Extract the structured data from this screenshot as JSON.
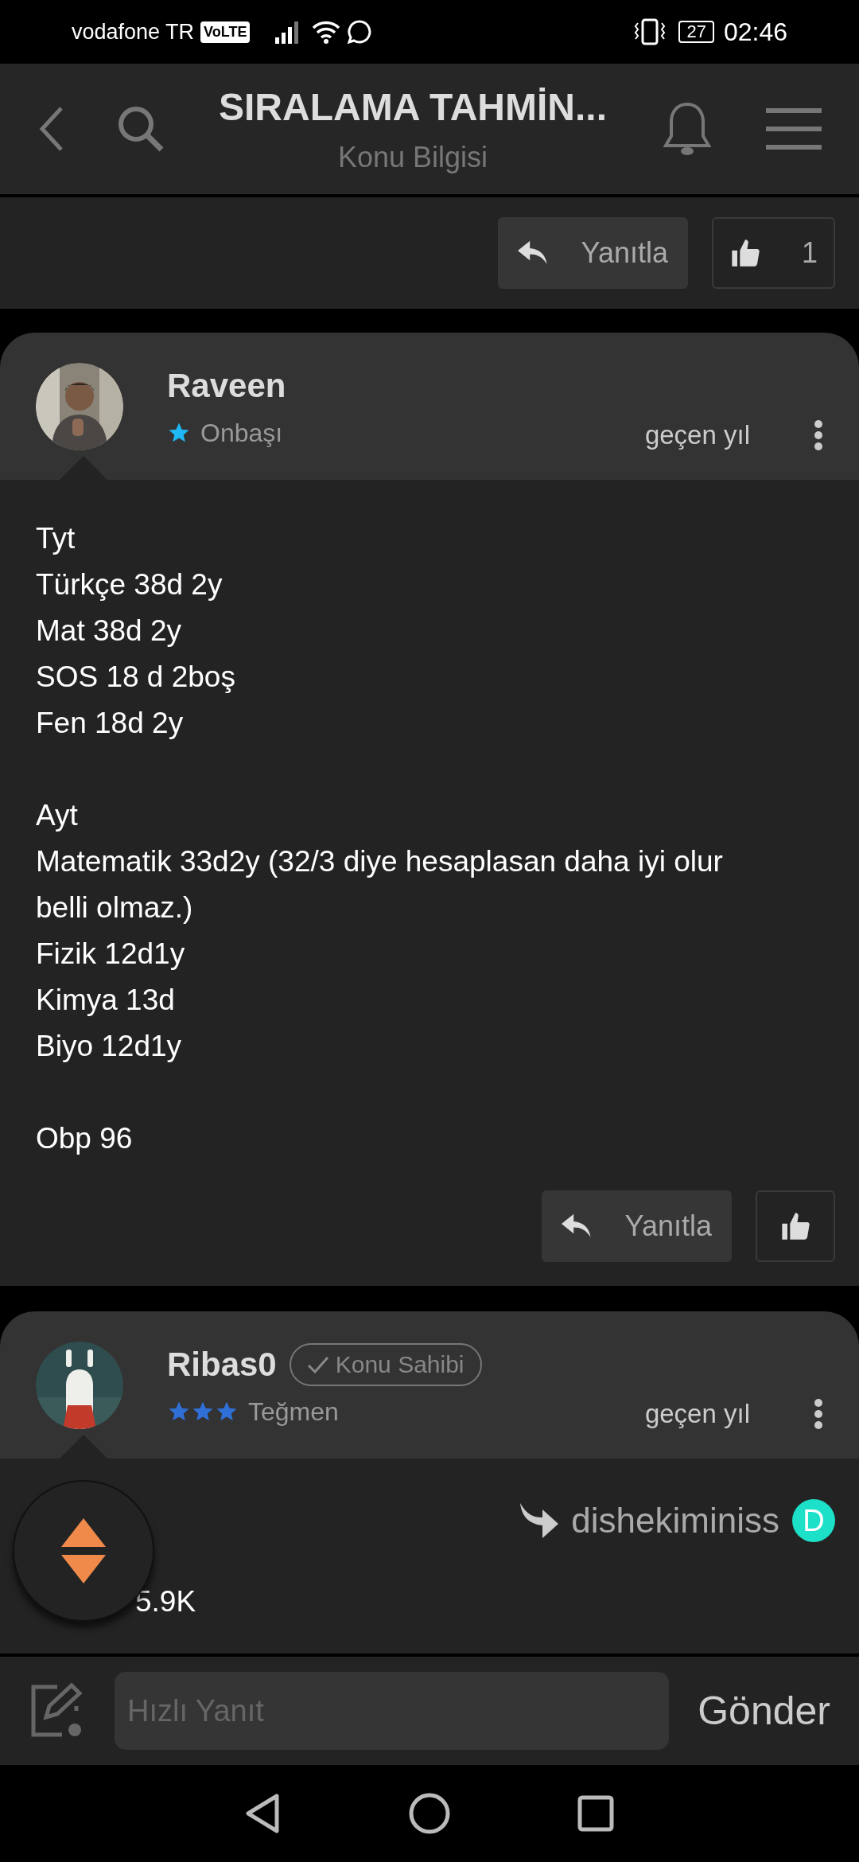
{
  "status_bar": {
    "carrier": "vodafone TR",
    "network_badge": "VoLTE",
    "battery": "27",
    "time": "02:46"
  },
  "header": {
    "title": "SIRALAMA TAHMİN...",
    "subtitle": "Konu Bilgisi"
  },
  "top_actions": {
    "reply": "Yanıtla",
    "likes": "1"
  },
  "posts": [
    {
      "user": "Raveen",
      "rank": "Onbaşı",
      "rank_stars": [
        {
          "filled": true
        }
      ],
      "color": "#1fb8f5",
      "time": "geçen yıl",
      "paragraphs": [
        [
          "Tyt",
          "Türkçe 38d 2y",
          "Mat 38d 2y",
          "SOS 18 d 2boş",
          "Fen 18d 2y"
        ],
        [
          "Ayt",
          "Matematik 33d2y (32/3 diye hesaplasan daha iyi olur belli olmaz.)",
          "Fizik 12d1y",
          "Kimya 13d",
          "Biyo 12d1y"
        ],
        [
          "Obp 96"
        ]
      ],
      "actions": {
        "reply": "Yanıtla"
      }
    },
    {
      "user": "Ribas0",
      "rank": "Teğmen",
      "rank_stars": [
        {
          "filled": true
        },
        {
          "filled": true
        },
        {
          "filled": true
        }
      ],
      "color": "#2f6fd6",
      "owner_badge": "Konu Sahibi",
      "time": "geçen yıl",
      "quote": {
        "user": "dishekiminiss",
        "initial": "D"
      },
      "paragraphs": [
        [
          "5.9K"
        ]
      ]
    }
  ],
  "quick_reply": {
    "placeholder": "Hızlı Yanıt",
    "send": "Gönder"
  }
}
